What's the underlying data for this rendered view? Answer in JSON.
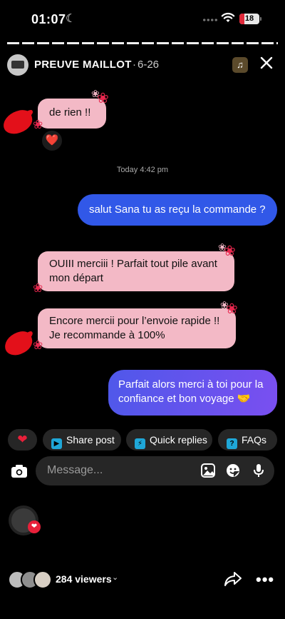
{
  "status": {
    "time": "01:07",
    "battery": "18"
  },
  "header": {
    "account": "PREUVE MAILLOT",
    "separator": "·",
    "date": "6-26"
  },
  "messages": [
    {
      "side": "left",
      "text": "de rien !!",
      "reaction": "❤️"
    },
    {
      "side": "right",
      "text": "salut Sana tu as reçu la commande ?"
    },
    {
      "side": "left",
      "text": "OUIII merciii ! Parfait tout pile avant mon départ"
    },
    {
      "side": "left",
      "text": "Encore mercii pour l’envoie rapide !! Je recommande à 100%"
    },
    {
      "side": "right",
      "text": "Parfait alors merci à toi pour la confiance et bon voyage 🤝"
    }
  ],
  "timestamp": "Today 4:42 pm",
  "quick_actions": {
    "share_post": "Share post",
    "quick_replies": "Quick replies",
    "faqs": "FAQs"
  },
  "composer": {
    "placeholder": "Message..."
  },
  "footer": {
    "viewers": "284 viewers"
  },
  "colors": {
    "pink_bubble": "#f3b9c6",
    "blue_bubble": "#3158e8",
    "accent_red": "#e8203a"
  }
}
